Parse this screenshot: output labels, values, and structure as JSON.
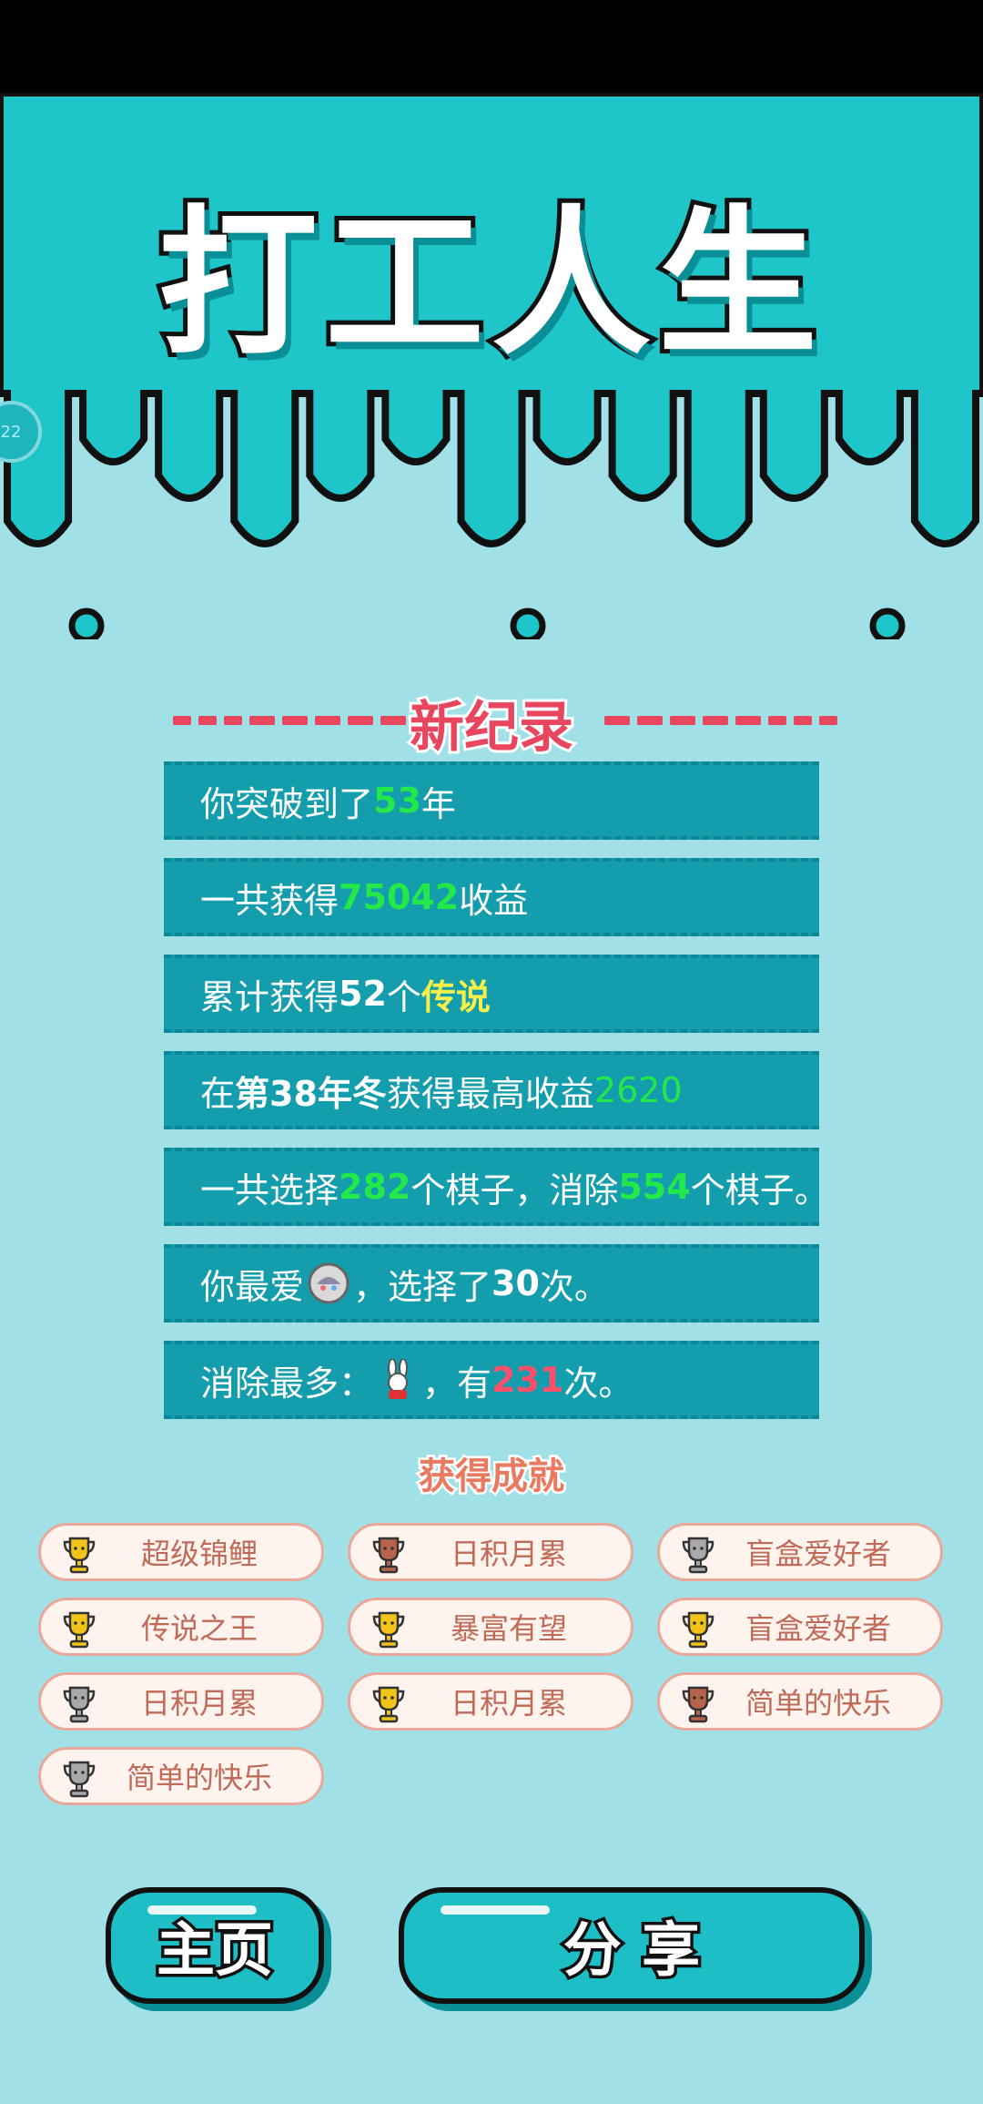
{
  "game": {
    "title": "打工人生"
  },
  "edge_badge": {
    "text": "22"
  },
  "record": {
    "title": "新纪录"
  },
  "stats": {
    "row1": {
      "prefix": "你突破到了",
      "years": "53",
      "suffix": "年"
    },
    "row2": {
      "prefix": "一共获得",
      "income": "75042",
      "suffix": "收益"
    },
    "row3": {
      "prefix": "累计获得",
      "count": "52",
      "mid": "个",
      "word": "传说"
    },
    "row4": {
      "prefix": "在 ",
      "season": "第38年冬",
      "mid": " 获得最高收益",
      "max_income": "2620"
    },
    "row5": {
      "prefix": "一共选择",
      "selected": "282",
      "mid": "个棋子，消除",
      "removed": "554",
      "suffix": "个棋子。"
    },
    "row6": {
      "prefix": "你最爱",
      "icon": "blind-box-icon",
      "mid": "，选择了",
      "times": "30",
      "suffix": "次。"
    },
    "row7": {
      "prefix": "消除最多：",
      "icon": "rabbit-icon",
      "mid": "，有",
      "times": "231",
      "suffix": "次。"
    }
  },
  "achievements": {
    "title": "获得成就",
    "items": [
      {
        "label": "超级锦鲤",
        "trophy": "gold"
      },
      {
        "label": "日积月累",
        "trophy": "bronze"
      },
      {
        "label": "盲盒爱好者",
        "trophy": "silver"
      },
      {
        "label": "传说之王",
        "trophy": "gold"
      },
      {
        "label": "暴富有望",
        "trophy": "gold"
      },
      {
        "label": "盲盒爱好者",
        "trophy": "gold"
      },
      {
        "label": "日积月累",
        "trophy": "silver"
      },
      {
        "label": "日积月累",
        "trophy": "gold"
      },
      {
        "label": "简单的快乐",
        "trophy": "bronze"
      },
      {
        "label": "简单的快乐",
        "trophy": "silver"
      }
    ]
  },
  "trophy_colors": {
    "gold": "#f2c41a",
    "silver": "#a9a9a9",
    "bronze": "#b8644a"
  },
  "buttons": {
    "home": "主页",
    "share": "分 享"
  },
  "colors": {
    "accent": "#1dbec5",
    "record_red": "#e8455e",
    "green": "#22e84a",
    "yellow": "#f3f04a"
  }
}
